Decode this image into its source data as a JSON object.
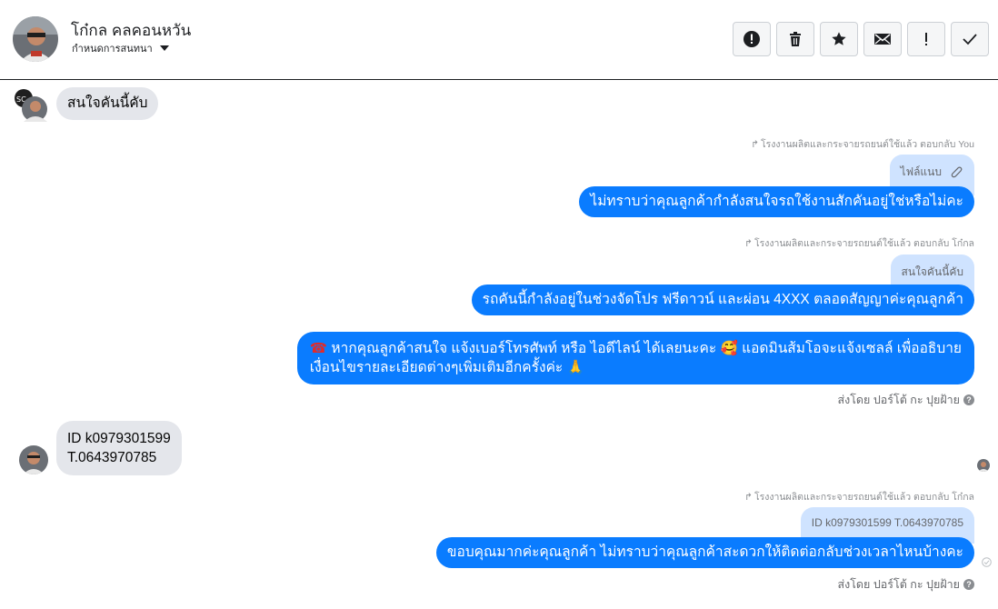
{
  "header": {
    "contact_name": "โก๋กล คลคอนหวัน",
    "label_selector": "กำหนดการสนทนา",
    "actions": [
      {
        "name": "report-spam-button",
        "icon": "alert-circle-icon"
      },
      {
        "name": "delete-button",
        "icon": "trash-icon"
      },
      {
        "name": "star-button",
        "icon": "star-icon"
      },
      {
        "name": "mark-unread-button",
        "icon": "envelope-icon"
      },
      {
        "name": "important-button",
        "icon": "exclamation-icon"
      },
      {
        "name": "mark-done-button",
        "icon": "check-icon"
      }
    ]
  },
  "messages": {
    "m1": {
      "text": "สนใจคันนี้คับ"
    },
    "m2": {
      "reply_meta": "โรงงานผลิตและกระจายรถยนต์ใช้แล้ว ตอบกลับ You",
      "quote": "ไฟล์แนบ",
      "text": "ไม่ทราบว่าคุณลูกค้ากำลังสนใจรถใช้งานสักคันอยู่ใช่หรือไม่คะ"
    },
    "m3": {
      "reply_meta": "โรงงานผลิตและกระจายรถยนต์ใช้แล้ว ตอบกลับ โก๋กล",
      "quote": "สนใจคันนี้คับ",
      "text": "รถคันนี้กำลังอยู่ในช่วงจัดโปร ฟรีดาวน์ และผ่อน 4XXX ตลอดสัญญาค่ะคุณลูกค้า"
    },
    "m4": {
      "line1_a": "หากคุณลูกค้าสนใจ แจ้งเบอร์โทรศัพท์ หรือ ไอดีไลน์  ได้เลยนะคะ ",
      "line1_b": "แอดมินส้มโอจะแจ้งเซลล์   เพื่ออธิบาย",
      "line2": "เงื่อนไขรายละเอียดต่างๆเพิ่มเติมอีกครั้งค่ะ",
      "emoji_phone": "☎",
      "emoji_love": "🥰",
      "emoji_pray": "🙏",
      "sent_by": "ส่งโดย ปอร์โต้ กะ ปุยฝ้าย"
    },
    "m5": {
      "line1": "ID k0979301599",
      "line2": "T.0643970785"
    },
    "m6": {
      "reply_meta": "โรงงานผลิตและกระจายรถยนต์ใช้แล้ว ตอบกลับ โก๋กล",
      "quote": "ID k0979301599 T.0643970785",
      "text": "ขอบคุณมากค่ะคุณลูกค้า ไม่ทราบว่าคุณลูกค้าสะดวกให้ติดต่อกลับช่วงเวลาไหนบ้างคะ",
      "sent_by": "ส่งโดย ปอร์โต้ กะ ปุยฝ้าย"
    }
  },
  "colors": {
    "outgoing_bubble": "#0a7cff",
    "incoming_bubble": "#e4e6eb",
    "quote_bubble": "#cfe3ff"
  }
}
